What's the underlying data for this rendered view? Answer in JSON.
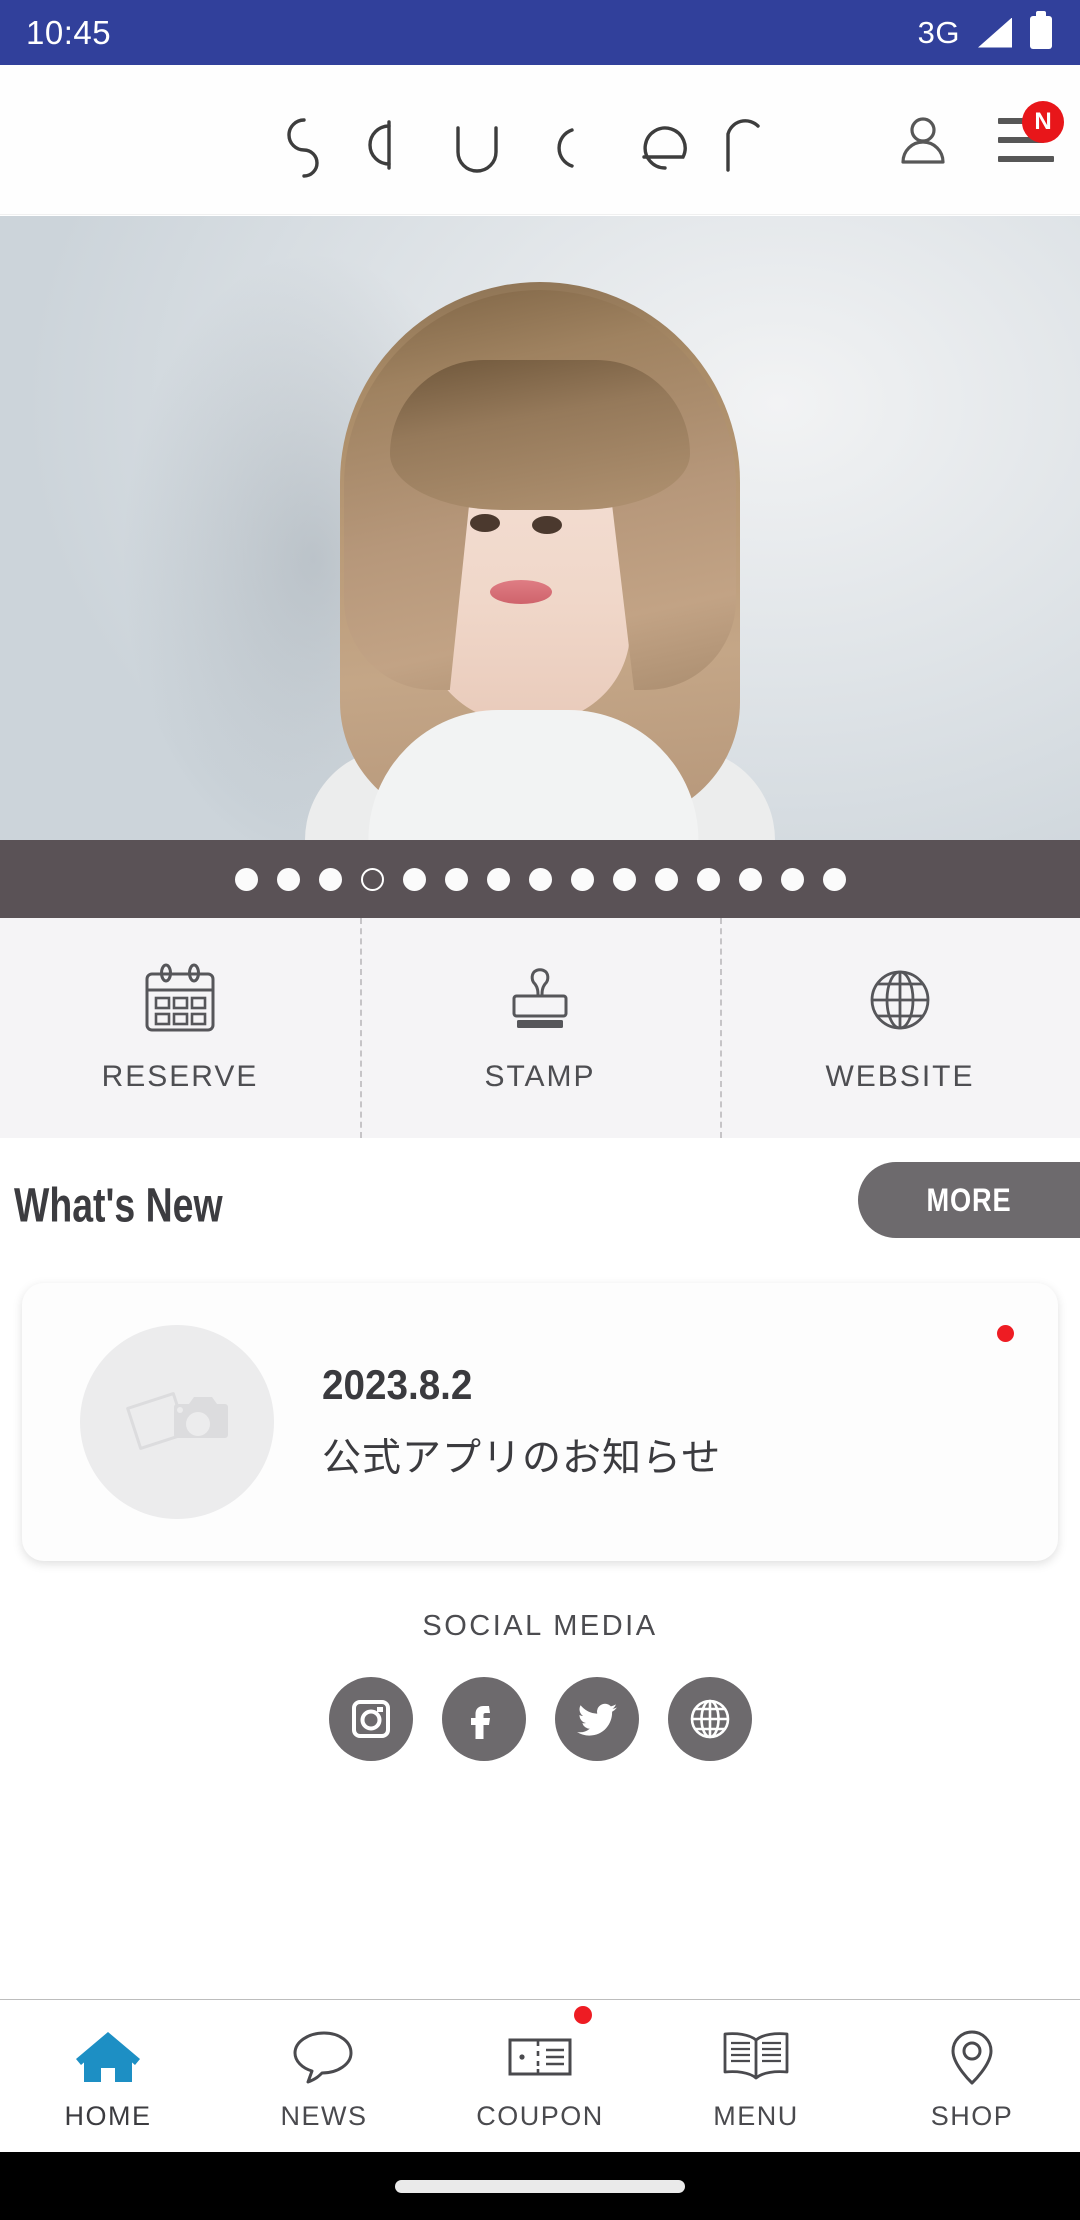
{
  "status_bar": {
    "time": "10:45",
    "network": "3G",
    "signal_icon": "signal-triangle-icon",
    "battery_icon": "battery-full-icon",
    "background_color": "#31409b"
  },
  "header": {
    "logo_text": "saucer",
    "account_icon": "person-icon",
    "menu_icon": "hamburger-menu-icon",
    "menu_badge": "N",
    "badge_color": "#e8161a"
  },
  "hero": {
    "alt": "hair salon model photo",
    "carousel": {
      "total_slides": 15,
      "active_index": 3,
      "bar_color": "#5a5256"
    }
  },
  "quick_actions": [
    {
      "label": "RESERVE",
      "icon": "calendar-icon"
    },
    {
      "label": "STAMP",
      "icon": "stamp-icon"
    },
    {
      "label": "WEBSITE",
      "icon": "globe-icon"
    }
  ],
  "whats_new": {
    "title": "What's New",
    "more_label": "MORE",
    "more_color": "#6d6a6d",
    "items": [
      {
        "date": "2023.8.2",
        "title": "公式アプリのお知らせ",
        "thumbnail_icon": "image-placeholder-icon",
        "unread": true,
        "unread_color": "#ee1c23"
      }
    ]
  },
  "social_media": {
    "label": "SOCIAL MEDIA",
    "circle_color": "#6d6a6d",
    "items": [
      {
        "name": "Instagram",
        "icon": "instagram-icon"
      },
      {
        "name": "Facebook",
        "icon": "facebook-icon"
      },
      {
        "name": "Twitter",
        "icon": "twitter-icon"
      },
      {
        "name": "Website",
        "icon": "globe-icon"
      }
    ]
  },
  "bottom_nav": {
    "active_color": "#1d8fc4",
    "items": [
      {
        "label": "HOME",
        "icon": "home-icon",
        "active": true,
        "badge": false
      },
      {
        "label": "NEWS",
        "icon": "speech-bubble-icon",
        "active": false,
        "badge": false
      },
      {
        "label": "COUPON",
        "icon": "ticket-icon",
        "active": false,
        "badge": true
      },
      {
        "label": "MENU",
        "icon": "open-book-icon",
        "active": false,
        "badge": false
      },
      {
        "label": "SHOP",
        "icon": "map-pin-icon",
        "active": false,
        "badge": false
      }
    ]
  },
  "system_nav": {
    "home_indicator": "home-indicator-pill"
  }
}
